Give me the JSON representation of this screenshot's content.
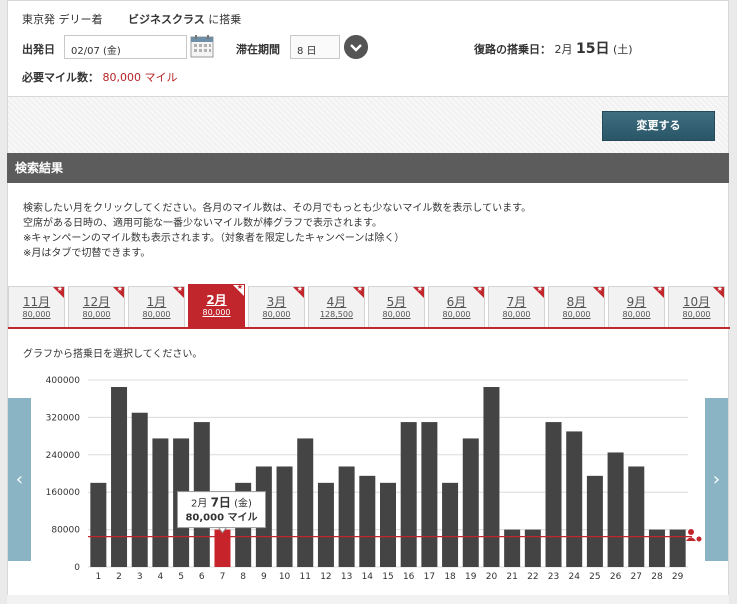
{
  "header": {
    "route": "東京発 デリー着",
    "cabin_class": "ビジネスクラス",
    "cabin_suffix": "に搭乗",
    "depart_label": "出発日",
    "depart_value": "02/07 (金)",
    "stay_label": "滞在期間",
    "stay_value": "8 日",
    "return_label": "復路の搭乗日：",
    "return_month": "2月",
    "return_day": "15日",
    "return_weekday": "(土)",
    "miles_label": "必要マイル数：",
    "miles_value": "80,000 マイル",
    "change_button": "変更する"
  },
  "results": {
    "title": "検索結果",
    "notes": [
      "検索したい月をクリックしてください。各月のマイル数は、その月でもっとも少ないマイル数を表示しています。",
      "空席がある日時の、適用可能な一番少ないマイル数が棒グラフで表示されます。",
      "※キャンペーンのマイル数も表示されます。（対象者を限定したキャンペーンは除く）",
      "※月はタブで切替できます。"
    ],
    "chart_instruction": "グラフから搭乗日を選択してください。"
  },
  "tabs": [
    {
      "month": "11月",
      "miles": "80,000"
    },
    {
      "month": "12月",
      "miles": "80,000"
    },
    {
      "month": "1月",
      "miles": "80,000"
    },
    {
      "month": "2月",
      "miles": "80,000",
      "active": true
    },
    {
      "month": "3月",
      "miles": "80,000"
    },
    {
      "month": "4月",
      "miles": "128,500"
    },
    {
      "month": "5月",
      "miles": "80,000"
    },
    {
      "month": "6月",
      "miles": "80,000"
    },
    {
      "month": "7月",
      "miles": "80,000"
    },
    {
      "month": "8月",
      "miles": "80,000"
    },
    {
      "month": "9月",
      "miles": "80,000"
    },
    {
      "month": "10月",
      "miles": "80,000"
    }
  ],
  "tab_badge": "★",
  "nav": {
    "prev_label": "‹",
    "next_label": "›"
  },
  "tooltip": {
    "month": "2月",
    "day": "7日",
    "weekday": "(金)",
    "miles": "80,000 マイル"
  },
  "colors": {
    "bar": "#444444",
    "selected": "#c7232a",
    "threshold_line": "#c0262c",
    "tab_active": "#c0262c",
    "nav_arrow": "#8ab3c3"
  },
  "chart_data": {
    "type": "bar",
    "categories": [
      "1",
      "2",
      "3",
      "4",
      "5",
      "6",
      "7",
      "8",
      "9",
      "10",
      "11",
      "12",
      "13",
      "14",
      "15",
      "16",
      "17",
      "18",
      "19",
      "20",
      "21",
      "22",
      "23",
      "24",
      "25",
      "26",
      "27",
      "28",
      "29"
    ],
    "values": [
      180000,
      385000,
      330000,
      275000,
      275000,
      310000,
      80000,
      180000,
      215000,
      215000,
      275000,
      180000,
      215000,
      195000,
      180000,
      310000,
      310000,
      180000,
      275000,
      385000,
      80000,
      80000,
      310000,
      290000,
      195000,
      245000,
      215000,
      80000,
      80000
    ],
    "selected_index": 6,
    "threshold": 65000,
    "yticks": [
      "400000",
      "320000",
      "240000",
      "160000",
      "80000",
      "0"
    ],
    "ylim": [
      0,
      400000
    ],
    "grid": true
  }
}
